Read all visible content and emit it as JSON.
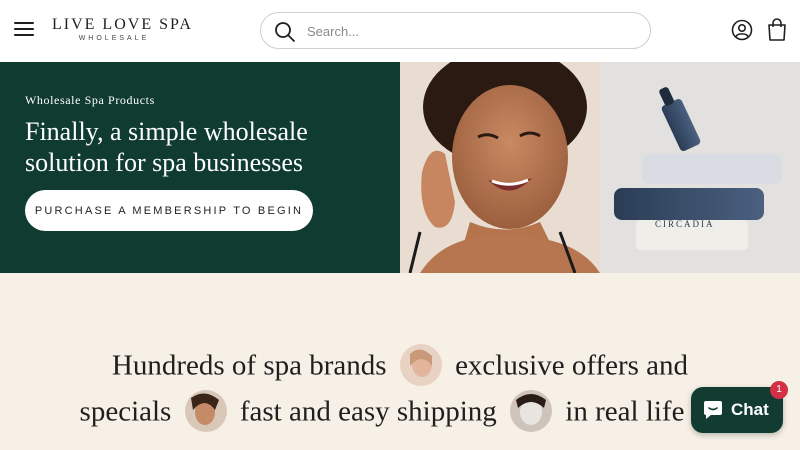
{
  "header": {
    "logo_main": "LIVE LOVE SPA",
    "logo_sub": "WHOLESALE",
    "search_placeholder": "Search..."
  },
  "hero": {
    "eyebrow": "Wholesale Spa Products",
    "title": "Finally, a simple wholesale solution for spa businesses",
    "cta_label": "PURCHASE A MEMBERSHIP TO BEGIN",
    "product_label": "CIRCADIA"
  },
  "brands": {
    "line1_part1": "Hundreds of spa brands",
    "line1_part2": "exclusive offers and",
    "line2_part1": "specials",
    "line2_part2": "fast and easy shipping",
    "line2_part3": "in real life"
  },
  "chat": {
    "label": "Chat",
    "badge": "1"
  },
  "colors": {
    "brand_green": "#0f3b30",
    "cream": "#f6f0e6",
    "badge_red": "#d32f45"
  }
}
